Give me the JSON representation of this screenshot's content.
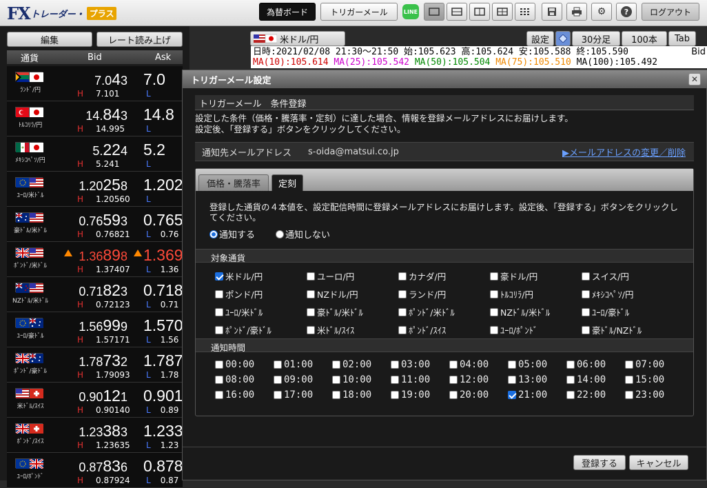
{
  "app": {
    "logo_fx": "FX",
    "logo_trader": "トレーダー・",
    "logo_plus": "プラス"
  },
  "topbar": {
    "board": "為替ボード",
    "trigger_mail": "トリガーメール",
    "line": "LINE",
    "logout": "ログアウト"
  },
  "left": {
    "edit": "編集",
    "read_rates": "レート読み上げ",
    "headers": {
      "currency": "通貨",
      "bid": "Bid",
      "ask": "Ask"
    },
    "rows": [
      {
        "name": "ﾗﾝﾄﾞ/円",
        "bid_a": "7.0",
        "bid_b": "4",
        "bid_c": "3",
        "ask_a": "7.0",
        "high": "7.101",
        "low": "",
        "up": false
      },
      {
        "name": "ﾄﾙｺﾘﾗ/円",
        "bid_a": "14.",
        "bid_b": "84",
        "bid_c": "3",
        "ask_a": "14.8",
        "high": "14.995",
        "low": "",
        "up": false
      },
      {
        "name": "ﾒｷｼｺﾍﾟｿ/円",
        "bid_a": "5.",
        "bid_b": "22",
        "bid_c": "4",
        "ask_a": "5.2",
        "high": "5.241",
        "low": "",
        "up": false
      },
      {
        "name": "ﾕｰﾛ/米ﾄﾞﾙ",
        "bid_a": "1.20",
        "bid_b": "25",
        "bid_c": "8",
        "ask_a": "1.202",
        "high": "1.20560",
        "low": "",
        "up": false
      },
      {
        "name": "豪ﾄﾞﾙ/米ﾄﾞﾙ",
        "bid_a": "0.76",
        "bid_b": "59",
        "bid_c": "3",
        "ask_a": "0.765",
        "high": "0.76821",
        "low": "0.76",
        "up": false
      },
      {
        "name": "ﾎﾟﾝﾄﾞ/米ﾄﾞﾙ",
        "bid_a": "1.36",
        "bid_b": "89",
        "bid_c": "8",
        "ask_a": "1.369",
        "high": "1.37407",
        "low": "1.36",
        "up": true
      },
      {
        "name": "NZﾄﾞﾙ/米ﾄﾞﾙ",
        "bid_a": "0.71",
        "bid_b": "82",
        "bid_c": "3",
        "ask_a": "0.718",
        "high": "0.72123",
        "low": "0.71",
        "up": false
      },
      {
        "name": "ﾕｰﾛ/豪ﾄﾞﾙ",
        "bid_a": "1.56",
        "bid_b": "99",
        "bid_c": "9",
        "ask_a": "1.570",
        "high": "1.57171",
        "low": "1.56",
        "up": false
      },
      {
        "name": "ﾎﾟﾝﾄﾞ/豪ﾄﾞﾙ",
        "bid_a": "1.78",
        "bid_b": "73",
        "bid_c": "2",
        "ask_a": "1.787",
        "high": "1.79093",
        "low": "1.78",
        "up": false
      },
      {
        "name": "米ﾄﾞﾙ/ｽｲｽ",
        "bid_a": "0.90",
        "bid_b": "12",
        "bid_c": "1",
        "ask_a": "0.901",
        "high": "0.90140",
        "low": "0.89",
        "up": false
      },
      {
        "name": "ﾎﾟﾝﾄﾞ/ｽｲｽ",
        "bid_a": "1.23",
        "bid_b": "38",
        "bid_c": "3",
        "ask_a": "1.233",
        "high": "1.23635",
        "low": "1.23",
        "up": false
      },
      {
        "name": "ﾕｰﾛ/ﾎﾟﾝﾄﾞ",
        "bid_a": "0.87",
        "bid_b": "83",
        "bid_c": "6",
        "ask_a": "0.878",
        "high": "0.87924",
        "low": "0.87",
        "up": false
      }
    ]
  },
  "chart": {
    "pair": "米ドル/円",
    "settings": "設定",
    "tf": "30分足",
    "count": "100本",
    "tab": "Tab",
    "line1": "日時:2021/02/08 21:30～21:50 始:105.623 高:105.624 安:105.588 終:105.590",
    "ma10": "MA(10):105.614",
    "ma25": "MA(25):105.542",
    "ma50": "MA(50):105.504",
    "ma75": "MA(75):105.510",
    "ma100": "MA(100):105.492",
    "bid": "Bid"
  },
  "modal": {
    "title": "トリガーメール設定",
    "close": "✕",
    "subhead": "トリガーメール　条件登録",
    "desc1": "設定した条件（価格・騰落率・定刻）に達した場合、情報を登録メールアドレスにお届けします。",
    "desc2": "設定後、「登録する」ボタンをクリックしてください。",
    "email_label": "通知先メールアドレス",
    "email": "s-oida@matsui.co.jp",
    "email_link": "▶メールアドレスの変更／削除",
    "tab1": "価格・騰落率",
    "tab2": "定刻",
    "pdesc": "登録した通貨の４本値を、設定配信時間に登録メールアドレスにお届けします。設定後、「登録する」ボタンをクリックしてください。",
    "notify_on": "通知する",
    "notify_off": "通知しない",
    "sect_currency": "対象通貨",
    "sect_time": "通知時間",
    "submit": "登録する",
    "cancel": "キャンセル",
    "currencies": [
      {
        "label": "米ドル/円",
        "checked": true
      },
      {
        "label": "ユーロ/円",
        "checked": false
      },
      {
        "label": "カナダ/円",
        "checked": false
      },
      {
        "label": "豪ドル/円",
        "checked": false
      },
      {
        "label": "スイス/円",
        "checked": false
      },
      {
        "label": "ポンド/円",
        "checked": false
      },
      {
        "label": "NZドル/円",
        "checked": false
      },
      {
        "label": "ランド/円",
        "checked": false
      },
      {
        "label": "ﾄﾙｺﾘﾗ/円",
        "checked": false
      },
      {
        "label": "ﾒｷｼｺﾍﾟｿ/円",
        "checked": false
      },
      {
        "label": "ﾕｰﾛ/米ﾄﾞﾙ",
        "checked": false
      },
      {
        "label": "豪ﾄﾞﾙ/米ﾄﾞﾙ",
        "checked": false
      },
      {
        "label": "ﾎﾟﾝﾄﾞ/米ﾄﾞﾙ",
        "checked": false
      },
      {
        "label": "NZﾄﾞﾙ/米ﾄﾞﾙ",
        "checked": false
      },
      {
        "label": "ﾕｰﾛ/豪ﾄﾞﾙ",
        "checked": false
      },
      {
        "label": "ﾎﾟﾝﾄﾞ/豪ﾄﾞﾙ",
        "checked": false
      },
      {
        "label": "米ﾄﾞﾙ/ｽｲｽ",
        "checked": false
      },
      {
        "label": "ﾎﾟﾝﾄﾞ/ｽｲｽ",
        "checked": false
      },
      {
        "label": "ﾕｰﾛ/ﾎﾟﾝﾄﾞ",
        "checked": false
      },
      {
        "label": "豪ﾄﾞﾙ/NZﾄﾞﾙ",
        "checked": false
      }
    ],
    "times": [
      {
        "label": "00:00",
        "checked": false
      },
      {
        "label": "01:00",
        "checked": false
      },
      {
        "label": "02:00",
        "checked": false
      },
      {
        "label": "03:00",
        "checked": false
      },
      {
        "label": "04:00",
        "checked": false
      },
      {
        "label": "05:00",
        "checked": false
      },
      {
        "label": "06:00",
        "checked": false
      },
      {
        "label": "07:00",
        "checked": false
      },
      {
        "label": "08:00",
        "checked": false
      },
      {
        "label": "09:00",
        "checked": false
      },
      {
        "label": "10:00",
        "checked": false
      },
      {
        "label": "11:00",
        "checked": false
      },
      {
        "label": "12:00",
        "checked": false
      },
      {
        "label": "13:00",
        "checked": false
      },
      {
        "label": "14:00",
        "checked": false
      },
      {
        "label": "15:00",
        "checked": false
      },
      {
        "label": "16:00",
        "checked": false
      },
      {
        "label": "17:00",
        "checked": false
      },
      {
        "label": "18:00",
        "checked": false
      },
      {
        "label": "19:00",
        "checked": false
      },
      {
        "label": "20:00",
        "checked": false
      },
      {
        "label": "21:00",
        "checked": true
      },
      {
        "label": "22:00",
        "checked": false
      },
      {
        "label": "23:00",
        "checked": false
      }
    ]
  }
}
